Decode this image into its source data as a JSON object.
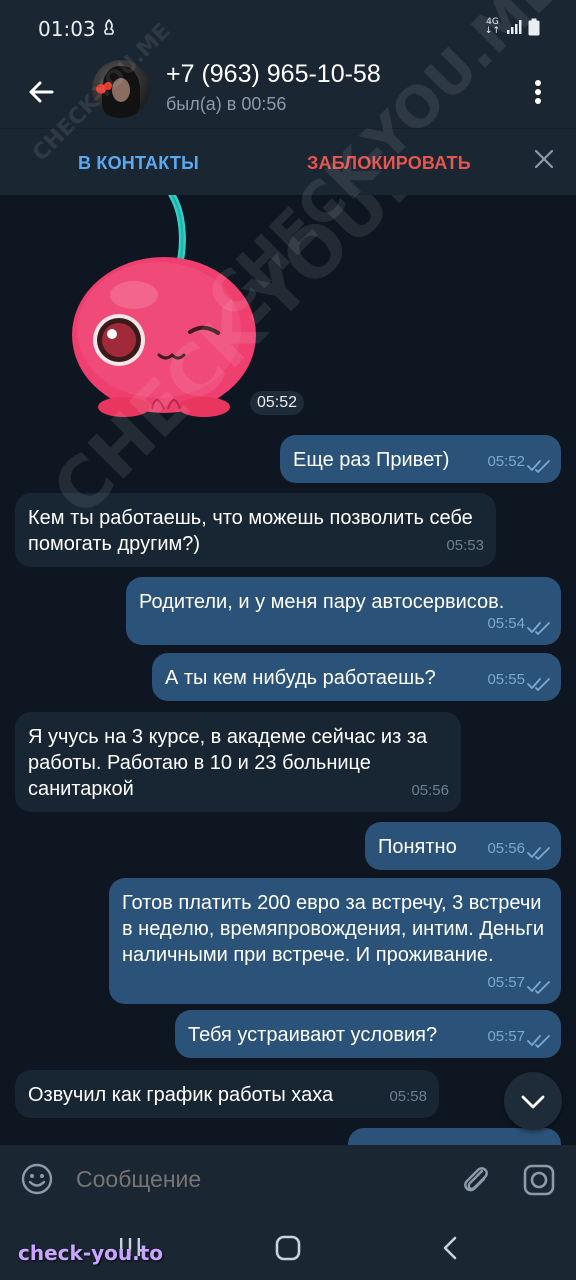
{
  "status_bar": {
    "time": "01:03",
    "network": "4G"
  },
  "header": {
    "contact_name": "+7 (963) 965-10-58",
    "last_seen": "был(а) в 00:56"
  },
  "action_bar": {
    "add_to_contacts": "В КОНТАКТЫ",
    "block": "ЗАБЛОКИРОВАТЬ"
  },
  "sticker": {
    "time": "05:52"
  },
  "messages": [
    {
      "direction": "out",
      "text": "Еще раз Привет)",
      "time": "05:52"
    },
    {
      "direction": "in",
      "text": "Кем ты работаешь, что можешь позволить себе помогать другим?)",
      "time": "05:53"
    },
    {
      "direction": "out",
      "text": "Родители, и у меня пару автосервисов.",
      "time": "05:54"
    },
    {
      "direction": "out",
      "text": "А ты кем нибудь работаешь?",
      "time": "05:55"
    },
    {
      "direction": "in",
      "text": "Я учусь на 3 курсе, в академе сейчас из за работы. Работаю в 10 и 23 больнице санитаркой",
      "time": "05:56"
    },
    {
      "direction": "out",
      "text": "Понятно",
      "time": "05:56"
    },
    {
      "direction": "out",
      "text": "Готов платить 200 евро за встречу, 3 встречи в неделю, времяпровождения, интим. Деньги наличными при встрече. И проживание.",
      "time": "05:57"
    },
    {
      "direction": "out",
      "text": "Тебя устраивают условия?",
      "time": "05:57"
    },
    {
      "direction": "in",
      "text": "Озвучил как график работы хаха",
      "time": "05:58"
    }
  ],
  "composer": {
    "placeholder": "Сообщение"
  },
  "watermarks": {
    "diagonal": "CHECK-YOU.ME",
    "bottom": "check-you.to"
  },
  "colors": {
    "accent_blue": "#5ba9ef",
    "block_red": "#e5564f",
    "outgoing_bubble": "#2b5278",
    "incoming_bubble": "#182533",
    "background": "#0e1621"
  }
}
